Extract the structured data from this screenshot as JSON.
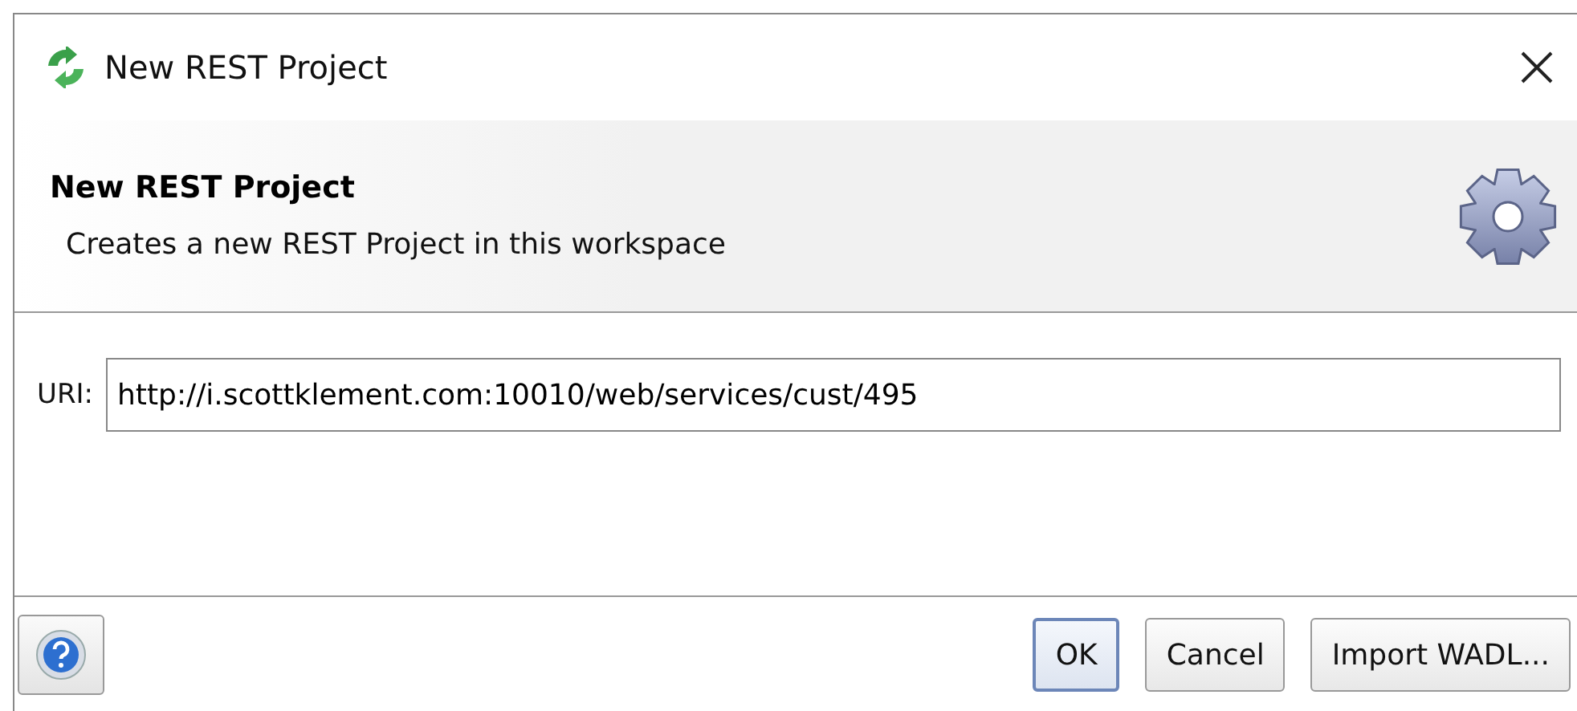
{
  "window": {
    "title": "New REST Project"
  },
  "header": {
    "title": "New REST Project",
    "description": "Creates a new REST Project in this workspace"
  },
  "uri": {
    "label": "URI:",
    "value": "http://i.scottklement.com:10010/web/services/cust/495"
  },
  "buttons": [
    {
      "label": "OK",
      "default": true
    },
    {
      "label": "Cancel",
      "default": false
    },
    {
      "label": "Import WADL...",
      "default": false
    }
  ]
}
